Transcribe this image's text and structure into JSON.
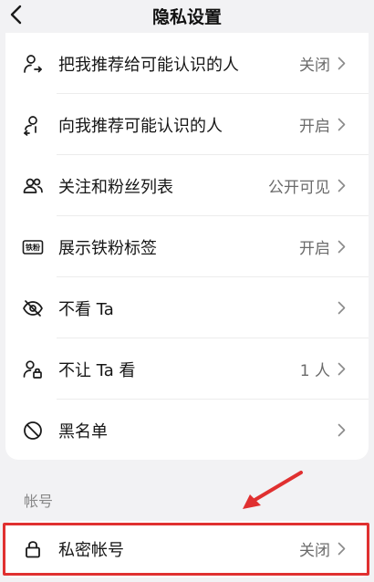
{
  "header": {
    "title": "隐私设置",
    "back_icon": "back-chevron-icon"
  },
  "privacy_settings": [
    {
      "id": "recommend-me",
      "label": "把我推荐给可能认识的人",
      "value": "关闭",
      "icon": "user-share-icon"
    },
    {
      "id": "recommend-to-me",
      "label": "向我推荐可能认识的人",
      "value": "开启",
      "icon": "user-recommend-icon"
    },
    {
      "id": "follow-fans-list",
      "label": "关注和粉丝列表",
      "value": "公开可见",
      "icon": "users-icon"
    },
    {
      "id": "iron-fan-tag",
      "label": "展示铁粉标签",
      "value": "开启",
      "icon": "iron-fan-badge-icon",
      "icon_text": "铁粉"
    },
    {
      "id": "hide-ta",
      "label": "不看 Ta",
      "value": "",
      "icon": "eye-off-icon"
    },
    {
      "id": "block-ta",
      "label": "不让 Ta 看",
      "value": "1 人",
      "icon": "user-lock-icon"
    },
    {
      "id": "blacklist",
      "label": "黑名单",
      "value": "",
      "icon": "block-icon"
    }
  ],
  "account_section": {
    "title": "帐号",
    "items": [
      {
        "id": "private-account",
        "label": "私密帐号",
        "value": "关闭",
        "icon": "lock-icon"
      }
    ]
  },
  "annotations": {
    "highlight_color": "#e03030"
  }
}
